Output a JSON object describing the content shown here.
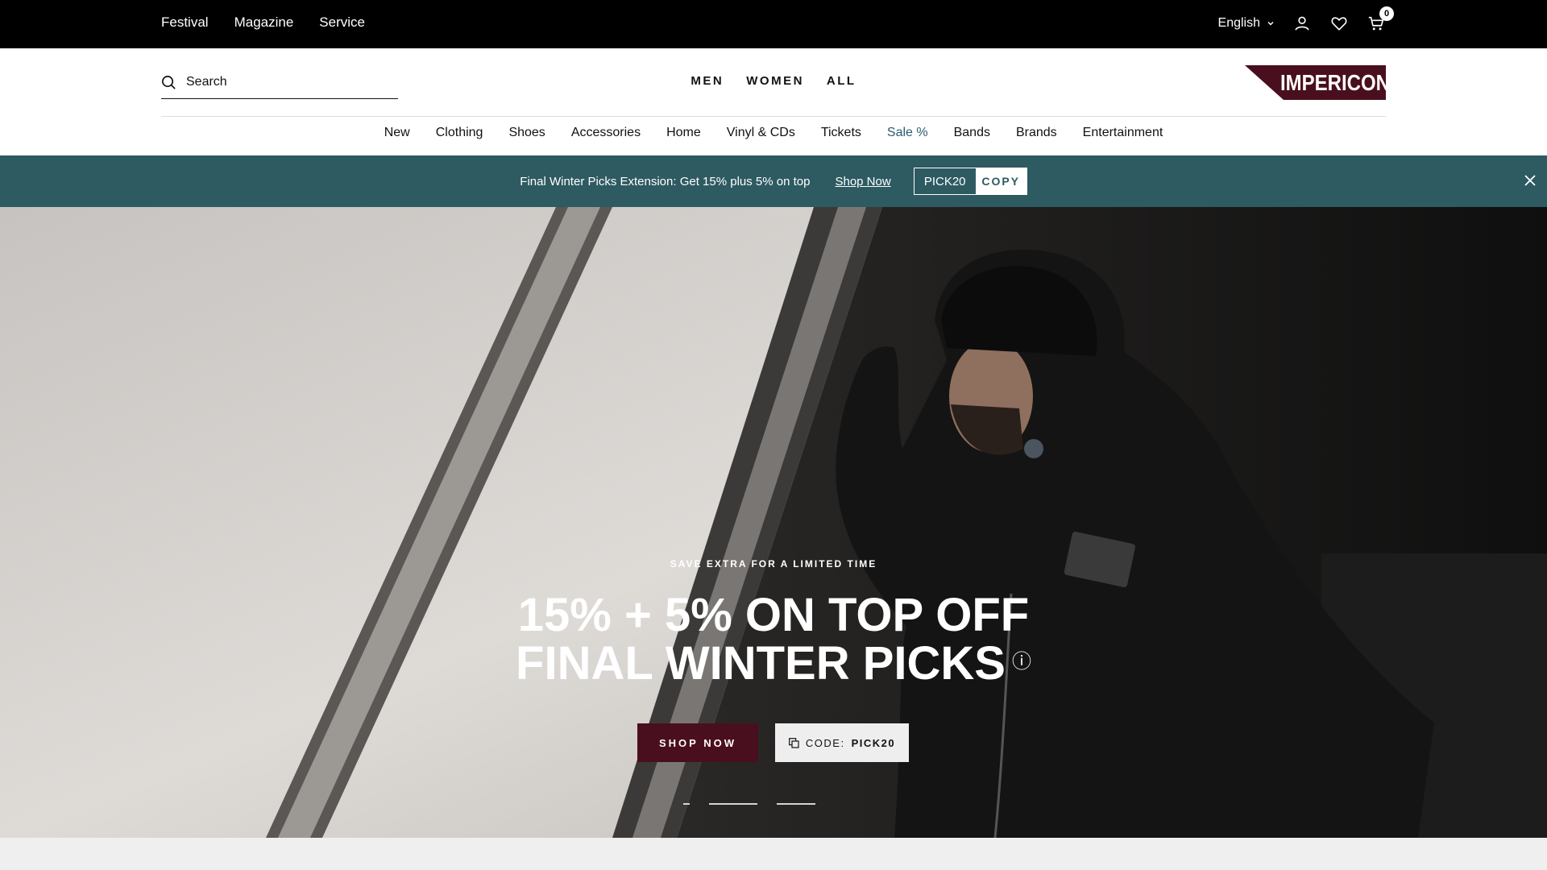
{
  "topbar": {
    "links": [
      "Festival",
      "Magazine",
      "Service"
    ],
    "language": "English",
    "cart_count": "0"
  },
  "header": {
    "search_placeholder": "Search",
    "gender_tabs": [
      "MEN",
      "WOMEN",
      "ALL"
    ],
    "logo_text": "IMPERICON",
    "nav": [
      "New",
      "Clothing",
      "Shoes",
      "Accessories",
      "Home",
      "Vinyl & CDs",
      "Tickets",
      "Sale %",
      "Bands",
      "Brands",
      "Entertainment"
    ],
    "accent_color": "#2a5d6e"
  },
  "promo": {
    "message": "Final Winter Picks Extension: Get 15% plus 5% on top",
    "link": "Shop Now",
    "code": "PICK20",
    "copy_label": "COPY",
    "bg_color": "#2e5a62"
  },
  "hero": {
    "eyebrow": "SAVE EXTRA FOR A LIMITED TIME",
    "headline_line1": "15% + 5% ON TOP OFF",
    "headline_line2": "FINAL WINTER PICKS",
    "info_symbol": "ⓘ",
    "shop_label": "SHOP NOW",
    "code_label": "CODE:",
    "code_value": "PICK20",
    "button_color": "#4a0f1e",
    "active_slide": 1,
    "slide_count": 3
  }
}
